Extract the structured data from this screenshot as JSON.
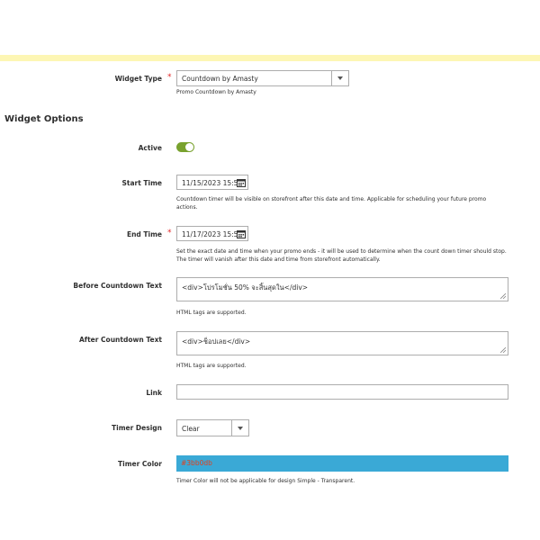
{
  "widget_type": {
    "label": "Widget Type",
    "required_mark": "*",
    "value": "Countdown by Amasty",
    "note": "Promo Countdown by Amasty"
  },
  "section_title": "Widget Options",
  "active": {
    "label": "Active",
    "value": true
  },
  "start_time": {
    "label": "Start Time",
    "value": "11/15/2023 15:5",
    "note_line1": "Countdown timer will be visible on storefront after this date and time. Applicable for scheduling your future promo",
    "note_line2": "actions."
  },
  "end_time": {
    "label": "End Time",
    "required_mark": "*",
    "value": "11/17/2023 15:5",
    "note_line1": "Set the exact date and time when your promo ends - it will be used to determine when the count down timer should stop.",
    "note_line2": "The timer will vanish after this date and time from storefront automatically."
  },
  "before_text": {
    "label": "Before Countdown Text",
    "value": "<div>โปรโมชั่น 50% จะสิ้นสุดใน</div>",
    "note": "HTML tags are supported."
  },
  "after_text": {
    "label": "After Countdown Text",
    "value": "<div>ช็อปเลย</div>",
    "note": "HTML tags are supported."
  },
  "link": {
    "label": "Link",
    "value": ""
  },
  "timer_design": {
    "label": "Timer Design",
    "value": "Clear"
  },
  "timer_color": {
    "label": "Timer Color",
    "value": "#3bb0db",
    "swatch_color": "#3aa9d6",
    "text_color": "#e0411f",
    "note": "Timer Color will not be applicable for design Simple - Transparent."
  },
  "icons": {
    "select_arrow": "chevron-down-icon",
    "calendar": "calendar-icon",
    "resize": "resize-handle-icon"
  },
  "colors": {
    "toggle_on": "#79a22e",
    "required": "#e22626",
    "message_bar": "#fdf6b4"
  }
}
